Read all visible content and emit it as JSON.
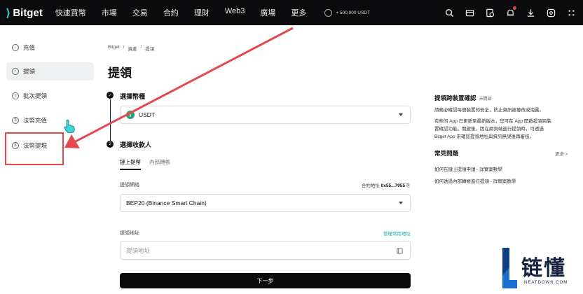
{
  "brand": {
    "name": "Bitget",
    "mark": "⟩"
  },
  "nav": {
    "items": [
      "快速買幣",
      "市場",
      "交易",
      "合約",
      "理財",
      "Web3",
      "廣場",
      "更多"
    ],
    "promo": "+ 500,000 USDT",
    "icons": [
      "search-icon",
      "wallet-icon",
      "history-icon",
      "bell-icon",
      "download-icon",
      "globe-icon",
      "menu-icon"
    ]
  },
  "sidebar": {
    "items": [
      {
        "label": "充值",
        "icon": "deposit-icon"
      },
      {
        "label": "提領",
        "icon": "withdraw-icon",
        "active": true
      },
      {
        "label": "批次提領",
        "icon": "batch-withdraw-icon"
      },
      {
        "label": "法幣充值",
        "icon": "fiat-deposit-icon"
      },
      {
        "label": "法幣提現",
        "icon": "fiat-withdraw-icon"
      }
    ]
  },
  "breadcrumb": [
    "Bitget",
    "/",
    "資產",
    "/",
    "提領"
  ],
  "page_title": "提領",
  "step1": {
    "num": "✓",
    "label": "選擇幣種",
    "coin": "USDT",
    "coin_glyph": "T"
  },
  "step2": {
    "num": "2",
    "label": "選擇收款人"
  },
  "tabs": [
    "鏈上提幣",
    "內部轉帳"
  ],
  "network": {
    "label": "提領網絡",
    "contract_label": "合約地址",
    "contract_value": "0x55...7955",
    "value": "BEP20 (Binance Smart Chain)"
  },
  "address": {
    "label": "提領地址",
    "manage_link": "管理常用地址",
    "placeholder": "提領地址"
  },
  "next_button": "下一步",
  "right_panel": {
    "confirm_title": "提領跨裝置確認",
    "confirm_sub": "未開啟",
    "confirm_text1": "請務必確認每個裝置的安全，防止資訊被篡改或洩露。",
    "confirm_text2": "有些的 App 已更新至最新版本，您可在 App 開啟提領跨裝置確認功能。開啟後，因在網頁端進行提領時，可透過 Bitget App 來確認提領地址與資訊無誤後再審核。",
    "faq_title": "常見問題",
    "faq_more": "更多 >",
    "faq_links": [
      "如何在鏈上提領申請 - 詳實案數學",
      "如何透過內部轉帳進行提領 - 詳實案教學"
    ]
  },
  "watermark": {
    "text": "链懂",
    "sub": "NEATDOWN.COM"
  },
  "colors": {
    "accent": "#11a8b0",
    "annotation": "#e5484d",
    "nav_bg": "#0b0b0d",
    "tether": "#26a17b"
  }
}
